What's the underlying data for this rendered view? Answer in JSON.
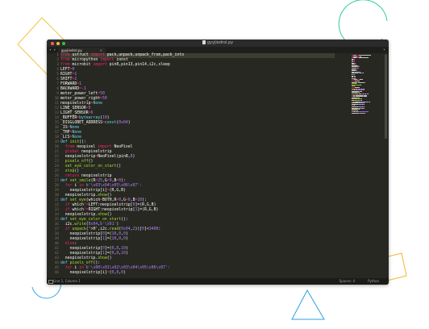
{
  "window": {
    "title": "gyyjiedrol.py",
    "tab_label": "gyyjiedrol.py",
    "nav": "◂ ▸",
    "close": "×",
    "menu": "▾"
  },
  "status": {
    "position": "Line 1, Column 1",
    "spaces": "Spaces: 4",
    "syntax": "Python"
  },
  "colors": {
    "keyword": "#f92672",
    "function": "#a6e22e",
    "number": "#ae81ff",
    "builtin": "#66d9ef",
    "default": "#f8f8f2",
    "comment": "#75715e"
  },
  "code_lines": [
    {
      "n": "1",
      "t": [
        [
          "from ",
          "keyword"
        ],
        [
          "ustruct ",
          "default"
        ],
        [
          "import ",
          "keyword"
        ],
        [
          "pack,unpack,unpack_from,pack_into",
          "default"
        ]
      ]
    },
    {
      "n": "2",
      "t": [
        [
          "from ",
          "keyword"
        ],
        [
          "micropython ",
          "default"
        ],
        [
          "import ",
          "keyword"
        ],
        [
          "const",
          "default"
        ]
      ]
    },
    {
      "n": "3",
      "t": [
        [
          "from ",
          "keyword"
        ],
        [
          "microbit ",
          "default"
        ],
        [
          "import ",
          "keyword"
        ],
        [
          "pin8,pin13,pin14,i2c,sleep",
          "default"
        ]
      ]
    },
    {
      "n": "4",
      "t": [
        [
          "LEFT",
          "default"
        ],
        [
          "=",
          "keyword"
        ],
        [
          "0",
          "number"
        ]
      ]
    },
    {
      "n": "5",
      "t": [
        [
          "RIGHT",
          "default"
        ],
        [
          "=",
          "keyword"
        ],
        [
          "1",
          "number"
        ]
      ]
    },
    {
      "n": "6",
      "t": [
        [
          "SHIFT",
          "default"
        ],
        [
          "=",
          "keyword"
        ],
        [
          "2",
          "number"
        ]
      ]
    },
    {
      "n": "7",
      "t": [
        [
          "FORWARD",
          "default"
        ],
        [
          "=",
          "keyword"
        ],
        [
          "1",
          "number"
        ]
      ]
    },
    {
      "n": "8",
      "t": [
        [
          "BACKWARD",
          "default"
        ],
        [
          "=",
          "keyword"
        ],
        [
          "-1",
          "number"
        ]
      ]
    },
    {
      "n": "9",
      "t": [
        [
          "motor_power_left",
          "default"
        ],
        [
          "=",
          "keyword"
        ],
        [
          "50",
          "number"
        ]
      ]
    },
    {
      "n": "10",
      "t": [
        [
          "motor_power_right",
          "default"
        ],
        [
          "=",
          "keyword"
        ],
        [
          "50",
          "number"
        ]
      ]
    },
    {
      "n": "11",
      "t": [
        [
          "neopixelstrip",
          "default"
        ],
        [
          "=",
          "keyword"
        ],
        [
          "None",
          "builtin"
        ]
      ]
    },
    {
      "n": "12",
      "t": [
        [
          "LINE_SENSOR",
          "default"
        ],
        [
          "=",
          "keyword"
        ],
        [
          "5",
          "number"
        ]
      ]
    },
    {
      "n": "13",
      "t": [
        [
          "LIGHT_SENSOR",
          "default"
        ],
        [
          "=",
          "keyword"
        ],
        [
          "6",
          "number"
        ]
      ]
    },
    {
      "n": "14",
      "t": [
        [
          "_BUFFER",
          "default"
        ],
        [
          "=",
          "keyword"
        ],
        [
          "bytearray",
          "builtin"
        ],
        [
          "(",
          "default"
        ],
        [
          "10",
          "number"
        ],
        [
          ")",
          "default"
        ]
      ]
    },
    {
      "n": "15",
      "t": [
        [
          "_DISGLOBET_ADDRESS",
          "default"
        ],
        [
          "=",
          "keyword"
        ],
        [
          "const",
          "builtin"
        ],
        [
          "(",
          "default"
        ],
        [
          "0x04",
          "number"
        ],
        [
          ")",
          "default"
        ]
      ]
    },
    {
      "n": "16",
      "t": [
        [
          "_IS",
          "default"
        ],
        [
          "=",
          "keyword"
        ],
        [
          "None",
          "builtin"
        ]
      ]
    },
    {
      "n": "17",
      "t": [
        [
          "_THP",
          "default"
        ],
        [
          "=",
          "keyword"
        ],
        [
          "None",
          "builtin"
        ]
      ]
    },
    {
      "n": "18",
      "t": [
        [
          "_LCS",
          "default"
        ],
        [
          "=",
          "keyword"
        ],
        [
          "None",
          "builtin"
        ]
      ]
    },
    {
      "n": "19",
      "t": [
        [
          "def ",
          "builtin"
        ],
        [
          "init",
          "function"
        ],
        [
          "():",
          "default"
        ]
      ]
    },
    {
      "n": "20",
      "t": [
        [
          "  from ",
          "keyword"
        ],
        [
          "neopixel ",
          "default"
        ],
        [
          "import ",
          "keyword"
        ],
        [
          "NeoPixel",
          "default"
        ]
      ]
    },
    {
      "n": "21",
      "t": [
        [
          "  global ",
          "keyword"
        ],
        [
          "neopixelstrip",
          "default"
        ]
      ]
    },
    {
      "n": "22",
      "t": [
        [
          "  neopixelstrip",
          "default"
        ],
        [
          "=",
          "keyword"
        ],
        [
          "NeoPixel",
          "default"
        ],
        [
          "(pin8,",
          "default"
        ],
        [
          "8",
          "number"
        ],
        [
          ")",
          "default"
        ]
      ]
    },
    {
      "n": "23",
      "t": [
        [
          "  pixels_off",
          "function"
        ],
        [
          "()",
          "default"
        ]
      ]
    },
    {
      "n": "24",
      "t": [
        [
          "  set_eye_color_on_start",
          "function"
        ],
        [
          "()",
          "default"
        ]
      ]
    },
    {
      "n": "25",
      "t": [
        [
          "  stop",
          "function"
        ],
        [
          "()",
          "default"
        ]
      ]
    },
    {
      "n": "26",
      "t": [
        [
          "  return ",
          "keyword"
        ],
        [
          "neopixelstrip",
          "default"
        ]
      ]
    },
    {
      "n": "27",
      "t": [
        [
          "def ",
          "builtin"
        ],
        [
          "set_smile",
          "function"
        ],
        [
          "(R",
          "default"
        ],
        [
          "=",
          "keyword"
        ],
        [
          "25",
          "number"
        ],
        [
          ",G",
          "default"
        ],
        [
          "=",
          "keyword"
        ],
        [
          "0",
          "number"
        ],
        [
          ",B",
          "default"
        ],
        [
          "=",
          "keyword"
        ],
        [
          "0",
          "number"
        ],
        [
          "):",
          "default"
        ]
      ]
    },
    {
      "n": "28",
      "t": [
        [
          "  for ",
          "keyword"
        ],
        [
          "i ",
          "default"
        ],
        [
          "in ",
          "keyword"
        ],
        [
          "b'\\x03\\x04\\x05\\x06\\x07':",
          "number"
        ]
      ]
    },
    {
      "n": "29",
      "t": [
        [
          "    neopixelstrip",
          "default"
        ],
        [
          "[i]",
          "default"
        ],
        [
          "=",
          "keyword"
        ],
        [
          "(R,G,B)",
          "default"
        ]
      ]
    },
    {
      "n": "30",
      "t": [
        [
          "  neopixelstrip.",
          "default"
        ],
        [
          "show",
          "function"
        ],
        [
          "()",
          "default"
        ]
      ]
    },
    {
      "n": "31",
      "t": [
        [
          "def ",
          "builtin"
        ],
        [
          "set_eye",
          "function"
        ],
        [
          "(which",
          "default"
        ],
        [
          "=",
          "keyword"
        ],
        [
          "BOTH",
          "default"
        ],
        [
          ",R",
          "default"
        ],
        [
          "=",
          "keyword"
        ],
        [
          "0",
          "number"
        ],
        [
          ",G",
          "default"
        ],
        [
          "=",
          "keyword"
        ],
        [
          "0",
          "number"
        ],
        [
          ",B",
          "default"
        ],
        [
          "=",
          "keyword"
        ],
        [
          "10",
          "number"
        ],
        [
          "):",
          "default"
        ]
      ]
    },
    {
      "n": "32",
      "t": [
        [
          "  if ",
          "keyword"
        ],
        [
          "which",
          "default"
        ],
        [
          "!=",
          "keyword"
        ],
        [
          "LEFT",
          "default"
        ],
        [
          ":neopixelstrip[",
          "default"
        ],
        [
          "0",
          "number"
        ],
        [
          "]=(R,G,B)",
          "default"
        ]
      ]
    },
    {
      "n": "33",
      "t": [
        [
          "  if ",
          "keyword"
        ],
        [
          "which",
          "default"
        ],
        [
          "!=",
          "keyword"
        ],
        [
          "RIGHT",
          "default"
        ],
        [
          ":neopixelstrip[",
          "default"
        ],
        [
          "1",
          "number"
        ],
        [
          "]=(R,G,B)",
          "default"
        ]
      ]
    },
    {
      "n": "34",
      "t": [
        [
          "  neopixelstrip.",
          "default"
        ],
        [
          "show",
          "function"
        ],
        [
          "()",
          "default"
        ]
      ]
    },
    {
      "n": "35",
      "t": [
        [
          "def ",
          "builtin"
        ],
        [
          "set_eye_color_on_start",
          "function"
        ],
        [
          "():",
          "default"
        ]
      ]
    },
    {
      "n": "36",
      "t": [
        [
          "  i2c.",
          "default"
        ],
        [
          "write",
          "function"
        ],
        [
          "(",
          "default"
        ],
        [
          "0x04",
          "number"
        ],
        [
          ",",
          "default"
        ],
        [
          "b'\\x01'",
          "number"
        ],
        [
          ")",
          "default"
        ]
      ]
    },
    {
      "n": "37",
      "t": [
        [
          "  if ",
          "keyword"
        ],
        [
          "unpack",
          "function"
        ],
        [
          "('>H',i2c.",
          "default"
        ],
        [
          "read",
          "function"
        ],
        [
          "(",
          "default"
        ],
        [
          "0x04",
          "number"
        ],
        [
          ",",
          "default"
        ],
        [
          "2",
          "number"
        ],
        [
          "))[",
          "default"
        ],
        [
          "0",
          "number"
        ],
        [
          "]<",
          "default"
        ],
        [
          "3400",
          "number"
        ],
        [
          ":",
          "default"
        ]
      ]
    },
    {
      "n": "38",
      "t": [
        [
          "    neopixelstrip[",
          "default"
        ],
        [
          "0",
          "number"
        ],
        [
          "]=(",
          "default"
        ],
        [
          "10",
          "number"
        ],
        [
          ",",
          "default"
        ],
        [
          "0",
          "number"
        ],
        [
          ",",
          "default"
        ],
        [
          "0",
          "number"
        ],
        [
          ")",
          "default"
        ]
      ]
    },
    {
      "n": "39",
      "t": [
        [
          "    neopixelstrip[",
          "default"
        ],
        [
          "1",
          "number"
        ],
        [
          "]=(",
          "default"
        ],
        [
          "10",
          "number"
        ],
        [
          ",",
          "default"
        ],
        [
          "0",
          "number"
        ],
        [
          ",",
          "default"
        ],
        [
          "0",
          "number"
        ],
        [
          ")",
          "default"
        ]
      ]
    },
    {
      "n": "40",
      "t": [
        [
          "  else",
          "keyword"
        ],
        [
          ":",
          "default"
        ]
      ]
    },
    {
      "n": "41",
      "t": [
        [
          "    neopixelstrip[",
          "default"
        ],
        [
          "0",
          "number"
        ],
        [
          "]=(",
          "default"
        ],
        [
          "0",
          "number"
        ],
        [
          ",",
          "default"
        ],
        [
          "0",
          "number"
        ],
        [
          ",",
          "default"
        ],
        [
          "10",
          "number"
        ],
        [
          ")",
          "default"
        ]
      ]
    },
    {
      "n": "42",
      "t": [
        [
          "    neopixelstrip[",
          "default"
        ],
        [
          "1",
          "number"
        ],
        [
          "]=(",
          "default"
        ],
        [
          "0",
          "number"
        ],
        [
          ",",
          "default"
        ],
        [
          "0",
          "number"
        ],
        [
          ",",
          "default"
        ],
        [
          "10",
          "number"
        ],
        [
          ")",
          "default"
        ]
      ]
    },
    {
      "n": "43",
      "t": [
        [
          "  neopixelstrip.",
          "default"
        ],
        [
          "show",
          "function"
        ],
        [
          "()",
          "default"
        ]
      ]
    },
    {
      "n": "44",
      "t": [
        [
          "def ",
          "builtin"
        ],
        [
          "pixels_off",
          "function"
        ],
        [
          "():",
          "default"
        ]
      ]
    },
    {
      "n": "45",
      "t": [
        [
          "  for ",
          "keyword"
        ],
        [
          "i ",
          "default"
        ],
        [
          "in ",
          "keyword"
        ],
        [
          "b'\\x00\\x01\\x02\\x03\\x04\\x05\\x06\\x07':",
          "number"
        ]
      ]
    },
    {
      "n": "46",
      "t": [
        [
          "    neopixelstrip[i]",
          "default"
        ],
        [
          "=",
          "keyword"
        ],
        [
          "(",
          "default"
        ],
        [
          "0",
          "number"
        ],
        [
          ",",
          "default"
        ],
        [
          "0",
          "number"
        ],
        [
          ",",
          "default"
        ],
        [
          "0",
          "number"
        ],
        [
          ")",
          "default"
        ]
      ]
    }
  ]
}
